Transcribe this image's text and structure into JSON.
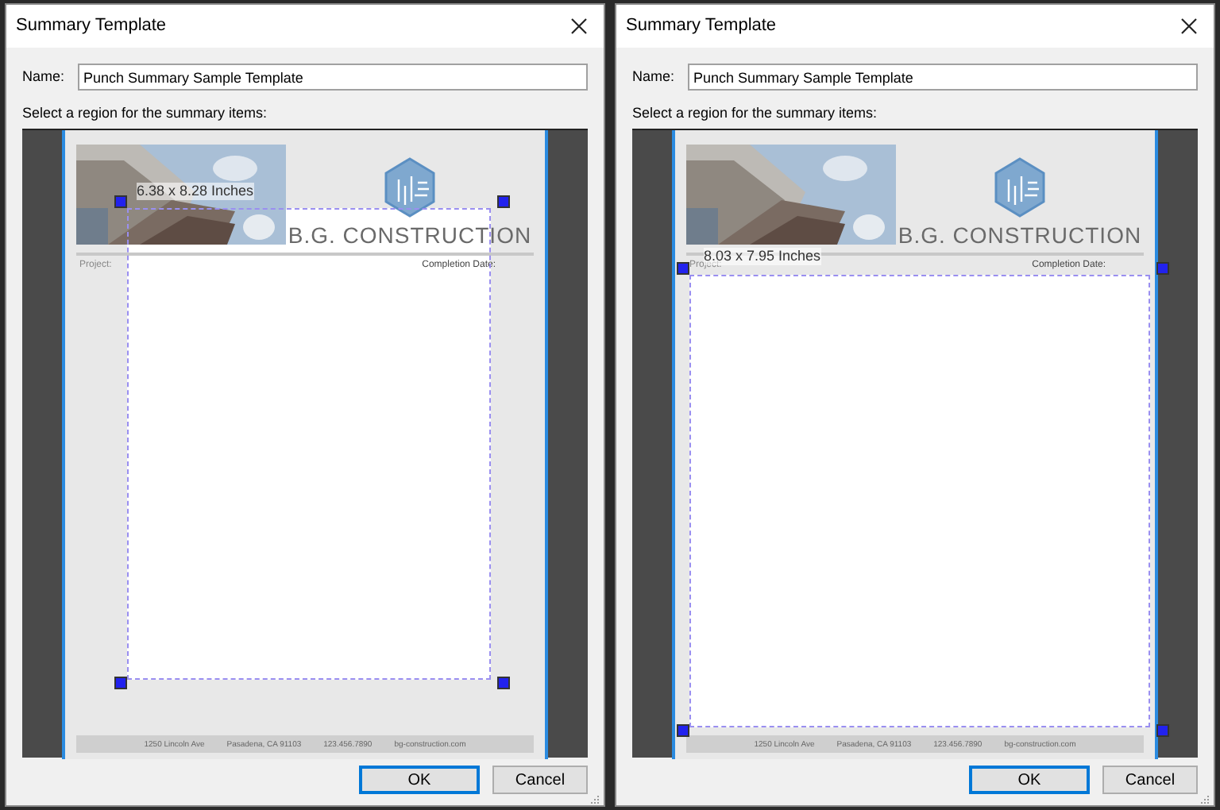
{
  "dialogs": [
    {
      "title": "Summary Template",
      "name_label": "Name:",
      "name_value": "Punch Summary Sample Template",
      "instruction": "Select a region for the summary items:",
      "template": {
        "company": "B.G. CONSTRUCTION",
        "project_label": "Project:",
        "completion_label": "Completion Date:",
        "footer": [
          "1250 Lincoln Ave",
          "Pasadena, CA 91103",
          "123.456.7890",
          "bg-construction.com"
        ]
      },
      "selection": {
        "size": "6.38 x 8.28 Inches"
      },
      "buttons": [
        {
          "label": "OK",
          "default": true
        },
        {
          "label": "Cancel",
          "default": false
        }
      ]
    },
    {
      "title": "Summary Template",
      "name_label": "Name:",
      "name_value": "Punch Summary Sample Template",
      "instruction": "Select a region for the summary items:",
      "template": {
        "company": "B.G. CONSTRUCTION",
        "project_label": "Project:",
        "completion_label": "Completion Date:",
        "footer": [
          "1250 Lincoln Ave",
          "Pasadena, CA 91103",
          "123.456.7890",
          "bg-construction.com"
        ]
      },
      "selection": {
        "size": "8.03 x 7.95 Inches"
      },
      "buttons": [
        {
          "label": "OK",
          "default": true
        },
        {
          "label": "Cancel",
          "default": false
        }
      ]
    }
  ]
}
